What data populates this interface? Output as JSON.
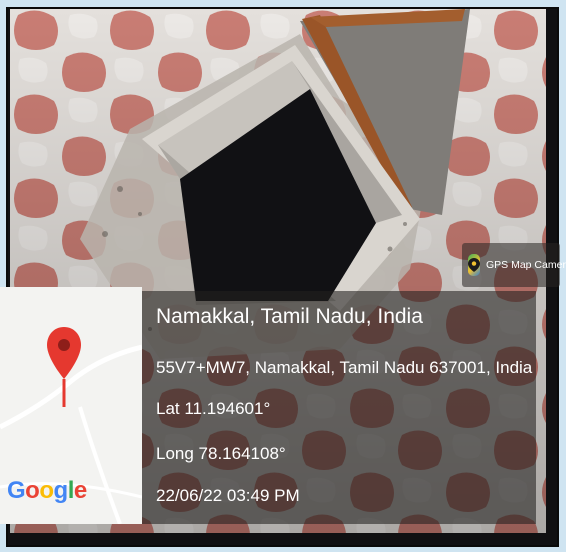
{
  "badge": {
    "label": "GPS Map Camera",
    "icon": "gps-map-camera-icon"
  },
  "location": {
    "title": "Namakkal, Tamil Nadu, India",
    "address": "55V7+MW7, Namakkal, Tamil Nadu 637001, India",
    "lat": "Lat 11.194601°",
    "long": "Long 78.164108°",
    "datetime": "22/06/22 03:49 PM"
  },
  "map": {
    "provider": [
      "G",
      "o",
      "o",
      "g",
      "l",
      "e"
    ],
    "provider_colors": [
      "#4285f4",
      "#ea4335",
      "#fbbc05",
      "#4285f4",
      "#34a853",
      "#ea4335"
    ],
    "pin_color": "#e5382f",
    "pin_icon": "map-pin-icon"
  },
  "colors": {
    "page_bg": "#cfe4f1",
    "paver_red": "#c98078",
    "paver_white": "#e7e4e1"
  }
}
